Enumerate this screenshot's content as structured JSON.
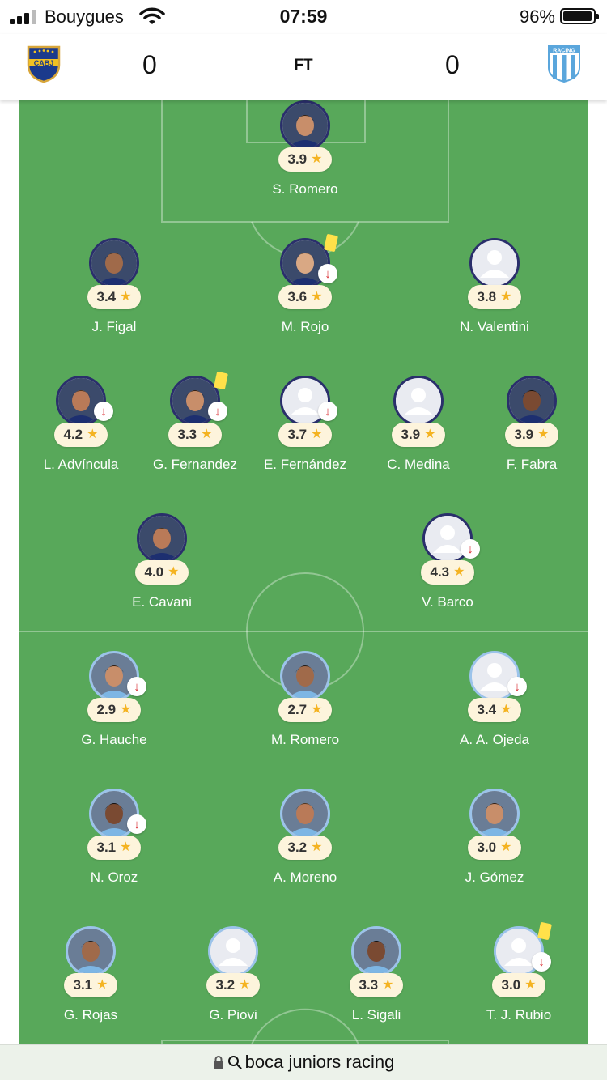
{
  "status_bar": {
    "carrier": "Bouygues",
    "time": "07:59",
    "battery_percent": "96%",
    "battery_level": 0.96,
    "signal_bars": 3
  },
  "match": {
    "home_team_logo": "CABJ",
    "away_team_logo": "RACING",
    "home_score": "0",
    "away_score": "0",
    "status": "FT",
    "colors": {
      "pitch": "#58a85a",
      "home_ring": "#2a2f6b",
      "away_ring": "#9bc3ea",
      "star": "#f4b321",
      "card": "#ffe14a",
      "sub_arrow": "#d8262c"
    }
  },
  "home_players": [
    {
      "name": "S. Romero",
      "rating": "3.9",
      "photo": true,
      "sub": false,
      "card": false
    },
    {
      "name": "J. Figal",
      "rating": "3.4",
      "photo": true,
      "sub": false,
      "card": false
    },
    {
      "name": "M. Rojo",
      "rating": "3.6",
      "photo": true,
      "sub": true,
      "card": true
    },
    {
      "name": "N. Valentini",
      "rating": "3.8",
      "photo": false,
      "sub": false,
      "card": false
    },
    {
      "name": "L. Advíncula",
      "rating": "4.2",
      "photo": true,
      "sub": true,
      "card": false
    },
    {
      "name": "G. Fernandez",
      "rating": "3.3",
      "photo": true,
      "sub": true,
      "card": true
    },
    {
      "name": "E. Fernández",
      "rating": "3.7",
      "photo": false,
      "sub": true,
      "card": false
    },
    {
      "name": "C. Medina",
      "rating": "3.9",
      "photo": false,
      "sub": false,
      "card": false
    },
    {
      "name": "F. Fabra",
      "rating": "3.9",
      "photo": true,
      "sub": false,
      "card": false
    },
    {
      "name": "E. Cavani",
      "rating": "4.0",
      "photo": true,
      "sub": false,
      "card": false
    },
    {
      "name": "V. Barco",
      "rating": "4.3",
      "photo": false,
      "sub": true,
      "card": false
    }
  ],
  "away_players": [
    {
      "name": "G. Hauche",
      "rating": "2.9",
      "photo": true,
      "sub": true,
      "card": false
    },
    {
      "name": "M. Romero",
      "rating": "2.7",
      "photo": true,
      "sub": false,
      "card": false
    },
    {
      "name": "A. A. Ojeda",
      "rating": "3.4",
      "photo": false,
      "sub": true,
      "card": false
    },
    {
      "name": "N. Oroz",
      "rating": "3.1",
      "photo": true,
      "sub": true,
      "card": false
    },
    {
      "name": "A. Moreno",
      "rating": "3.2",
      "photo": true,
      "sub": false,
      "card": false
    },
    {
      "name": "J. Gómez",
      "rating": "3.0",
      "photo": true,
      "sub": false,
      "card": false
    },
    {
      "name": "G. Rojas",
      "rating": "3.1",
      "photo": true,
      "sub": false,
      "card": false
    },
    {
      "name": "G. Piovi",
      "rating": "3.2",
      "photo": false,
      "sub": false,
      "card": false
    },
    {
      "name": "L. Sigali",
      "rating": "3.3",
      "photo": true,
      "sub": false,
      "card": false
    },
    {
      "name": "T. J. Rubio",
      "rating": "3.0",
      "photo": false,
      "sub": true,
      "card": true
    }
  ],
  "search_bar": {
    "query": "boca juniors racing"
  }
}
